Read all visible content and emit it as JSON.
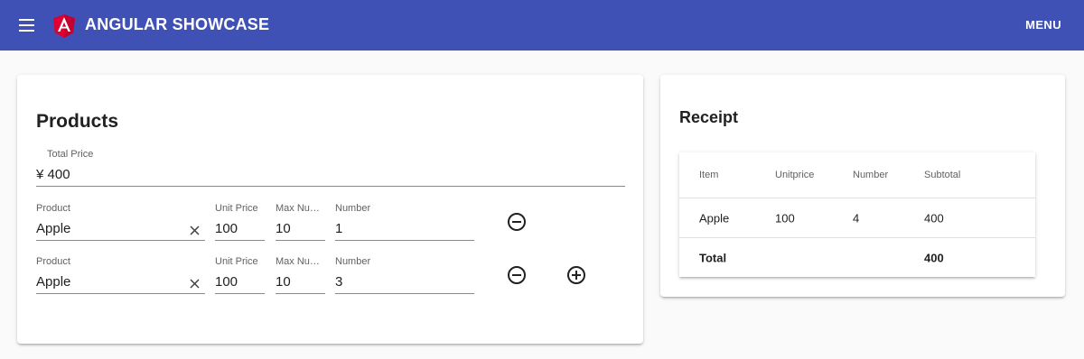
{
  "header": {
    "title": "ANGULAR SHOWCASE",
    "menu_label": "MENU",
    "color": "#3f51b5"
  },
  "products": {
    "heading": "Products",
    "total": {
      "label": "Total Price",
      "value": "¥ 400"
    },
    "rows": [
      {
        "product": {
          "label": "Product",
          "value": "Apple"
        },
        "unit_price": {
          "label": "Unit Price",
          "value": "100"
        },
        "max_number": {
          "label": "Max Number",
          "value": "10"
        },
        "number": {
          "label": "Number",
          "value": "1"
        }
      },
      {
        "product": {
          "label": "Product",
          "value": "Apple"
        },
        "unit_price": {
          "label": "Unit Price",
          "value": "100"
        },
        "max_number": {
          "label": "Max Number",
          "value": "10"
        },
        "number": {
          "label": "Number",
          "value": "3"
        }
      }
    ],
    "icons": {
      "remove": "remove-circle-icon",
      "add": "add-circle-icon",
      "clear": "close-icon"
    }
  },
  "receipt": {
    "heading": "Receipt",
    "columns": [
      "Item",
      "Unitprice",
      "Number",
      "Subtotal"
    ],
    "rows": [
      {
        "item": "Apple",
        "unitprice": "100",
        "number": "4",
        "subtotal": "400"
      }
    ],
    "footer": {
      "label": "Total",
      "total": "400"
    }
  }
}
